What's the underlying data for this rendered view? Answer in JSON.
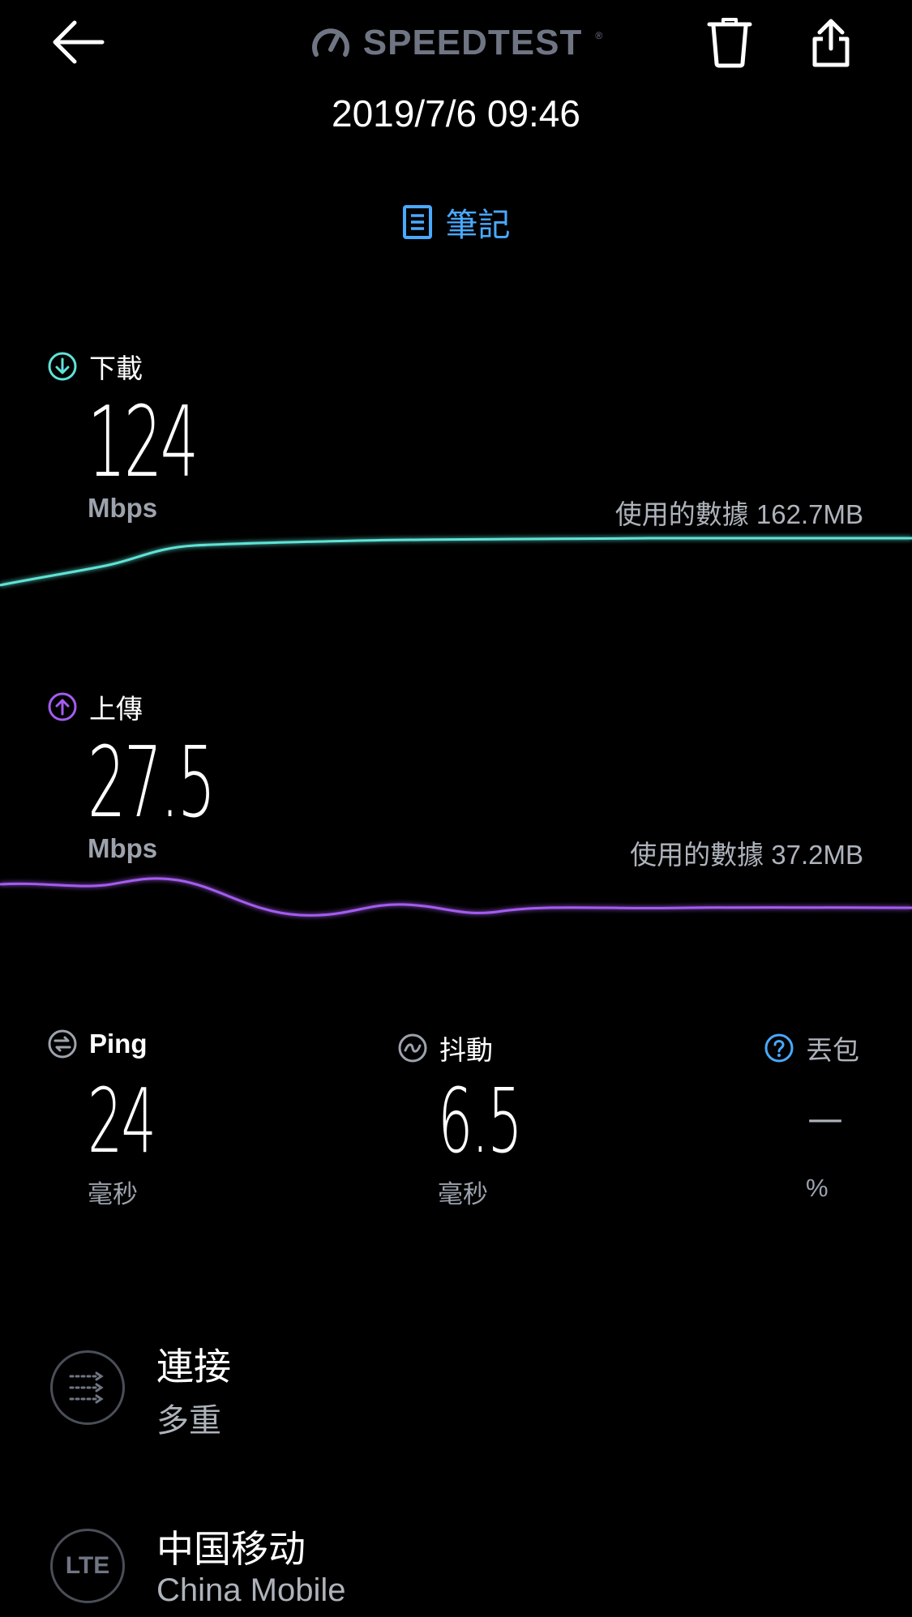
{
  "header": {
    "brand": "SPEEDTEST",
    "brand_tm": "®",
    "back_icon": "arrow-left-icon",
    "delete_icon": "trash-icon",
    "share_icon": "share-icon"
  },
  "result": {
    "datetime": "2019/7/6 09:46",
    "note_label": "筆記"
  },
  "download": {
    "label": "下載",
    "value": "124",
    "unit": "Mbps",
    "data_used": "使用的數據 162.7MB",
    "color": "#5fe3d6"
  },
  "upload": {
    "label": "上傳",
    "value": "27.5",
    "unit": "Mbps",
    "data_used": "使用的數據 37.2MB",
    "color": "#a45cf0"
  },
  "metrics": {
    "ping": {
      "label": "Ping",
      "value": "24",
      "unit": "毫秒"
    },
    "jitter": {
      "label": "抖動",
      "value": "6.5",
      "unit": "毫秒"
    },
    "loss": {
      "label": "丟包",
      "value": "—",
      "unit": "%"
    }
  },
  "connection": {
    "title": "連接",
    "subtitle": "多重"
  },
  "carrier": {
    "badge": "LTE",
    "title": "中国移动",
    "subtitle": "China Mobile"
  }
}
